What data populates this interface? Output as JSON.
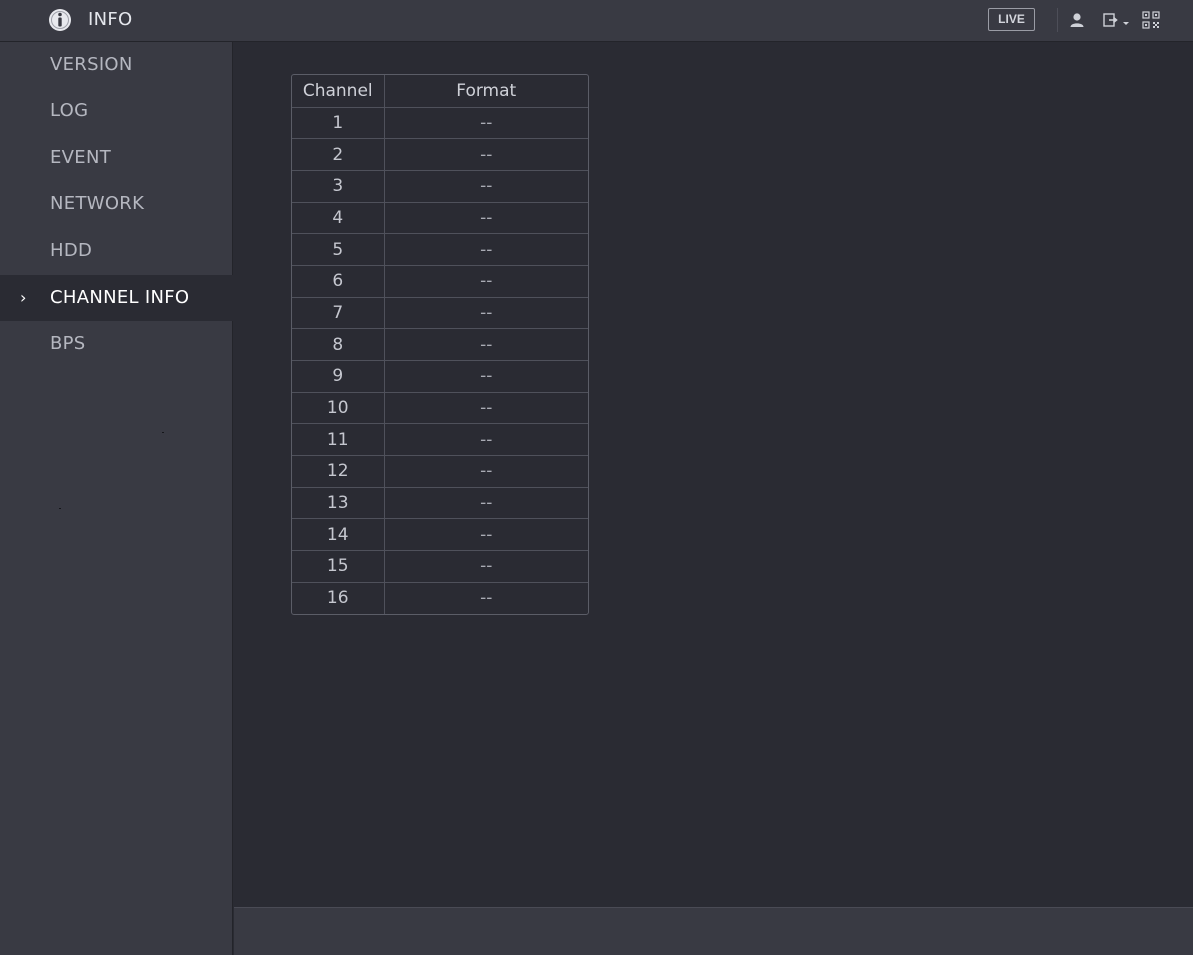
{
  "header": {
    "title": "INFO",
    "live_label": "LIVE"
  },
  "icons": {
    "title": "info-icon",
    "user": "user-icon",
    "logout": "logout-icon",
    "qr": "qr-code-icon"
  },
  "sidebar": {
    "items": [
      {
        "label": "VERSION",
        "active": false
      },
      {
        "label": "LOG",
        "active": false
      },
      {
        "label": "EVENT",
        "active": false
      },
      {
        "label": "NETWORK",
        "active": false
      },
      {
        "label": "HDD",
        "active": false
      },
      {
        "label": "CHANNEL INFO",
        "active": true
      },
      {
        "label": "BPS",
        "active": false
      }
    ],
    "active_chevron": "›"
  },
  "table": {
    "columns": [
      "Channel",
      "Format"
    ],
    "rows": [
      [
        "1",
        "--"
      ],
      [
        "2",
        "--"
      ],
      [
        "3",
        "--"
      ],
      [
        "4",
        "--"
      ],
      [
        "5",
        "--"
      ],
      [
        "6",
        "--"
      ],
      [
        "7",
        "--"
      ],
      [
        "8",
        "--"
      ],
      [
        "9",
        "--"
      ],
      [
        "10",
        "--"
      ],
      [
        "11",
        "--"
      ],
      [
        "12",
        "--"
      ],
      [
        "13",
        "--"
      ],
      [
        "14",
        "--"
      ],
      [
        "15",
        "--"
      ],
      [
        "16",
        "--"
      ]
    ]
  },
  "colors": {
    "background": "#2a2b33",
    "panel": "#393a43",
    "text": "#c8cad2",
    "active_text": "#ffffff"
  }
}
